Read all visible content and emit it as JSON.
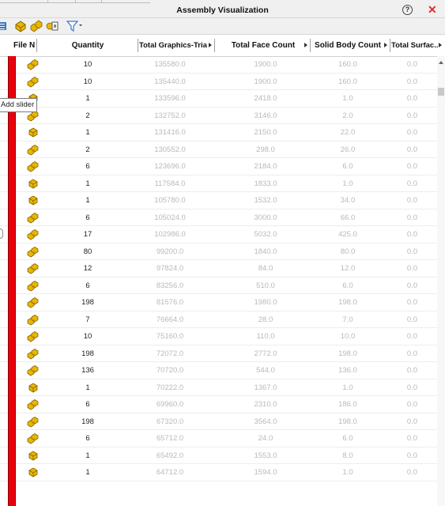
{
  "window": {
    "title": "Assembly Visualization"
  },
  "icons": {
    "help": "help-icon",
    "close": "close-icon",
    "toolbar": [
      "list-icon",
      "part-icon",
      "assembly-icon",
      "property-icon",
      "filter-icon"
    ]
  },
  "colors": {
    "accent_red": "#e8000f",
    "close_red": "#d9302a",
    "part_gold": "#e8b800",
    "dim_text": "#b9b9b9"
  },
  "tooltip": {
    "text": "Add slider"
  },
  "columns": {
    "file": "File N",
    "quantity": "Quantity",
    "graphics": "Total Graphics-Tria...",
    "faces": "Total Face Count",
    "solids": "Solid Body Count",
    "surfaces": "Total Surfac..."
  },
  "rows": [
    {
      "type": "assembly",
      "quantity": "10",
      "graphics": "135580.0",
      "faces": "1900.0",
      "solids": "160.0",
      "surfaces": "0.0"
    },
    {
      "type": "assembly",
      "quantity": "10",
      "graphics": "135440.0",
      "faces": "1900.0",
      "solids": "160.0",
      "surfaces": "0.0"
    },
    {
      "type": "part",
      "quantity": "1",
      "graphics": "133596.0",
      "faces": "2418.0",
      "solids": "1.0",
      "surfaces": "0.0"
    },
    {
      "type": "assembly",
      "quantity": "2",
      "graphics": "132752.0",
      "faces": "3146.0",
      "solids": "2.0",
      "surfaces": "0.0"
    },
    {
      "type": "part",
      "quantity": "1",
      "graphics": "131416.0",
      "faces": "2150.0",
      "solids": "22.0",
      "surfaces": "0.0"
    },
    {
      "type": "assembly",
      "quantity": "2",
      "graphics": "130552.0",
      "faces": "298.0",
      "solids": "26.0",
      "surfaces": "0.0"
    },
    {
      "type": "assembly",
      "quantity": "6",
      "graphics": "123696.0",
      "faces": "2184.0",
      "solids": "6.0",
      "surfaces": "0.0"
    },
    {
      "type": "part",
      "quantity": "1",
      "graphics": "117584.0",
      "faces": "1833.0",
      "solids": "1.0",
      "surfaces": "0.0"
    },
    {
      "type": "part",
      "quantity": "1",
      "graphics": "105780.0",
      "faces": "1532.0",
      "solids": "34.0",
      "surfaces": "0.0"
    },
    {
      "type": "assembly",
      "quantity": "6",
      "graphics": "105024.0",
      "faces": "3000.0",
      "solids": "66.0",
      "surfaces": "0.0"
    },
    {
      "type": "assembly",
      "quantity": "17",
      "graphics": "102986.0",
      "faces": "5032.0",
      "solids": "425.0",
      "surfaces": "0.0"
    },
    {
      "type": "assembly",
      "quantity": "80",
      "graphics": "99200.0",
      "faces": "1840.0",
      "solids": "80.0",
      "surfaces": "0.0"
    },
    {
      "type": "assembly",
      "quantity": "12",
      "graphics": "97824.0",
      "faces": "84.0",
      "solids": "12.0",
      "surfaces": "0.0"
    },
    {
      "type": "assembly",
      "quantity": "6",
      "graphics": "83256.0",
      "faces": "510.0",
      "solids": "6.0",
      "surfaces": "0.0"
    },
    {
      "type": "assembly",
      "quantity": "198",
      "graphics": "81576.0",
      "faces": "1980.0",
      "solids": "198.0",
      "surfaces": "0.0"
    },
    {
      "type": "assembly",
      "quantity": "7",
      "graphics": "76664.0",
      "faces": "28.0",
      "solids": "7.0",
      "surfaces": "0.0"
    },
    {
      "type": "assembly",
      "quantity": "10",
      "graphics": "75160.0",
      "faces": "110.0",
      "solids": "10.0",
      "surfaces": "0.0"
    },
    {
      "type": "assembly",
      "quantity": "198",
      "graphics": "72072.0",
      "faces": "2772.0",
      "solids": "198.0",
      "surfaces": "0.0"
    },
    {
      "type": "assembly",
      "quantity": "136",
      "graphics": "70720.0",
      "faces": "544.0",
      "solids": "136.0",
      "surfaces": "0.0"
    },
    {
      "type": "part",
      "quantity": "1",
      "graphics": "70222.0",
      "faces": "1367.0",
      "solids": "1.0",
      "surfaces": "0.0"
    },
    {
      "type": "assembly",
      "quantity": "6",
      "graphics": "69960.0",
      "faces": "2310.0",
      "solids": "186.0",
      "surfaces": "0.0"
    },
    {
      "type": "assembly",
      "quantity": "198",
      "graphics": "67320.0",
      "faces": "3564.0",
      "solids": "198.0",
      "surfaces": "0.0"
    },
    {
      "type": "assembly",
      "quantity": "6",
      "graphics": "65712.0",
      "faces": "24.0",
      "solids": "6.0",
      "surfaces": "0.0"
    },
    {
      "type": "part",
      "quantity": "1",
      "graphics": "65492.0",
      "faces": "1553.0",
      "solids": "8.0",
      "surfaces": "0.0"
    },
    {
      "type": "part",
      "quantity": "1",
      "graphics": "64712.0",
      "faces": "1594.0",
      "solids": "1.0",
      "surfaces": "0.0"
    }
  ]
}
